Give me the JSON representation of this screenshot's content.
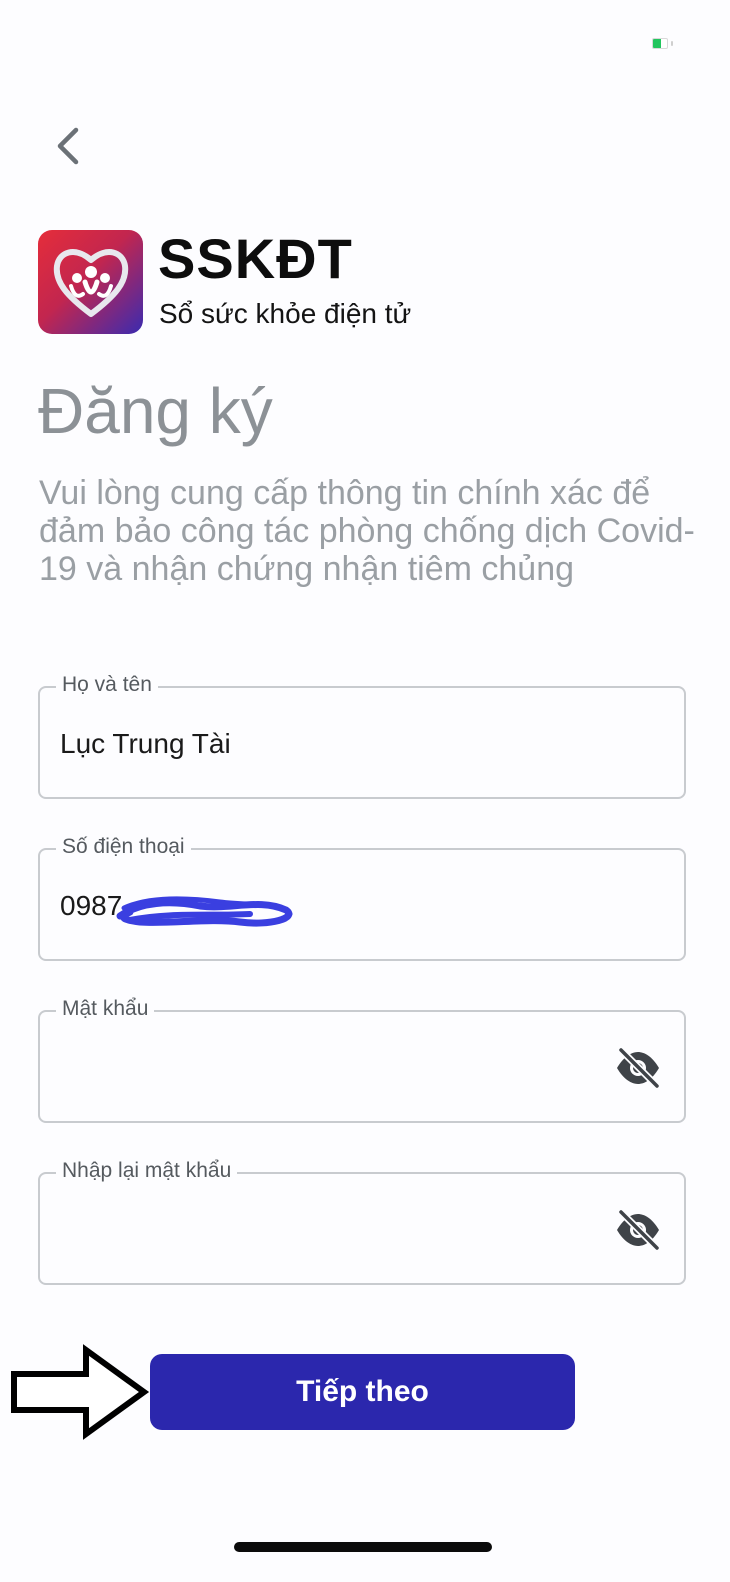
{
  "status_bar": {
    "battery_level": 0.55
  },
  "header": {
    "back_icon": "chevron-left-icon",
    "app_name": "SSKĐT",
    "app_subtitle": "Sổ sức khỏe điện tử",
    "logo_icon": "heart-family-logo"
  },
  "form": {
    "title": "Đăng ký",
    "description": "Vui lòng cung cấp thông tin chính xác để đảm bảo công tác phòng chống dịch Covid-19 và nhận chứng nhận tiêm chủng",
    "fields": [
      {
        "label": "Họ và tên",
        "value": "Lục Trung Tài"
      },
      {
        "label": "Số điện thoại",
        "value": "0987"
      },
      {
        "label": "Mật khẩu",
        "value": "",
        "icon": "eye-slash-icon"
      },
      {
        "label": "Nhập lại mật khẩu",
        "value": "",
        "icon": "eye-slash-icon"
      }
    ],
    "submit_label": "Tiếp theo"
  },
  "colors": {
    "primary_button": "#2b27ad",
    "redaction_scribble": "#3a3fe0",
    "title_gray": "#8c9196"
  }
}
